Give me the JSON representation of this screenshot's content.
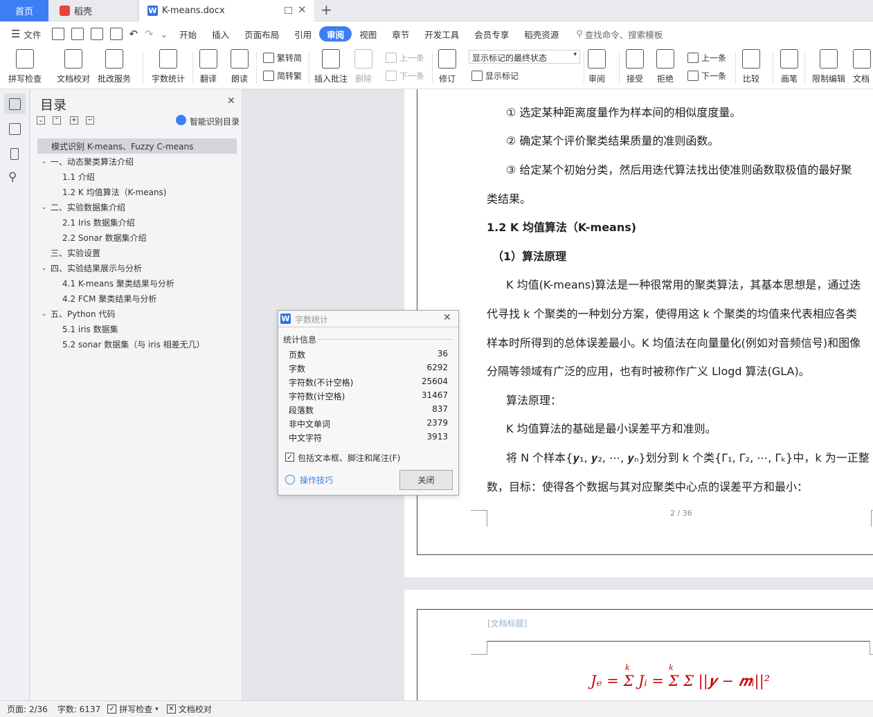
{
  "tabs": {
    "home": "首页",
    "daoke": "稻壳",
    "doc": "K-means.docx",
    "add": "+"
  },
  "menu": {
    "file": "文件",
    "items": [
      "开始",
      "插入",
      "页面布局",
      "引用",
      "审阅",
      "视图",
      "章节",
      "开发工具",
      "会员专享",
      "稻壳资源"
    ],
    "active": "审阅",
    "search": "查找命令、搜索模板"
  },
  "ribbon": {
    "spell": "拼写检查",
    "proof": "文档校对",
    "batch": "批改服务",
    "wordcount": "字数统计",
    "translate": "翻译",
    "read": "朗读",
    "trad": "繁转简",
    "simp": "简转繁",
    "insert_comment": "插入批注",
    "delete": "删除",
    "prev": "上一条",
    "next": "下一条",
    "revise": "修订",
    "markup_state": "显示标记的最终状态",
    "show_markup": "显示标记",
    "review": "审阅",
    "accept": "接受",
    "reject": "拒绝",
    "prev2": "上一条",
    "next2": "下一条",
    "compare": "比较",
    "pen": "画笔",
    "restrict": "限制编辑",
    "docperm": "文档"
  },
  "nav": {
    "title": "目录",
    "smart": "智能识别目录",
    "items": [
      {
        "text": "模式识别  K-means、Fuzzy C-means",
        "level": 0,
        "sel": true
      },
      {
        "text": "一、动态聚类算法介绍",
        "level": 1,
        "chev": true
      },
      {
        "text": "1.1  介绍",
        "level": 2
      },
      {
        "text": "1.2 K 均值算法（K-means)",
        "level": 2
      },
      {
        "text": "二、实验数据集介绍",
        "level": 1,
        "chev": true
      },
      {
        "text": "2.1 Iris 数据集介绍",
        "level": 2
      },
      {
        "text": "2.2 Sonar 数据集介绍",
        "level": 2
      },
      {
        "text": "三、实验设置",
        "level": 1
      },
      {
        "text": "四、实验结果展示与分析",
        "level": 1,
        "chev": true
      },
      {
        "text": "4.1 K-means 聚类结果与分析",
        "level": 2
      },
      {
        "text": "4.2 FCM 聚类结果与分析",
        "level": 2
      },
      {
        "text": "五、Python 代码",
        "level": 1,
        "chev": true
      },
      {
        "text": "5.1 iris 数据集",
        "level": 2
      },
      {
        "text": "5.2 sonar 数据集（与 iris 相差无几）",
        "level": 2
      }
    ]
  },
  "doc": {
    "lines": [
      "① 选定某种距离度量作为样本间的相似度度量。",
      "② 确定某个评价聚类结果质量的准则函数。",
      "③ 给定某个初始分类，然后用迭代算法找出使准则函数取极值的最好聚",
      "类结果。",
      "1.2 K 均值算法（K-means)",
      "（1）算法原理",
      "K 均值(K-means)算法是一种很常用的聚类算法，其基本思想是，通过迭",
      "代寻找 k 个聚类的一种划分方案，使得用这 k 个聚类的均值来代表相应各类",
      "样本时所得到的总体误差最小。K 均值法在向量量化(例如对音频信号)和图像",
      "分隔等领域有广泛的应用，也有时被称作广义 Llogd 算法(GLA)。",
      "算法原理：",
      "K 均值算法的基础是最小误差平方和准则。",
      "将 N 个样本{𝒚₁, 𝒚₂, ⋯, 𝒚ₙ}划分到 k 个类{Γ₁, Γ₂, ⋯, Γₖ}中，k 为一正整",
      "数，目标：使得各个数据与其对应聚类中心点的误差平方和最小："
    ],
    "page_num": "2 / 36",
    "header_placeholder": "[文档标题]",
    "formula": "Jₑ = Σ Jᵢ = Σ Σ ||𝒚 − 𝒎ᵢ||²",
    "formula_sup": "k"
  },
  "dialog": {
    "title": "字数统计",
    "section": "统计信息",
    "rows": [
      {
        "label": "页数",
        "value": "36"
      },
      {
        "label": "字数",
        "value": "6292"
      },
      {
        "label": "字符数(不计空格)",
        "value": "25604"
      },
      {
        "label": "字符数(计空格)",
        "value": "31467"
      },
      {
        "label": "段落数",
        "value": "837"
      },
      {
        "label": "非中文单词",
        "value": "2379"
      },
      {
        "label": "中文字符",
        "value": "3913"
      }
    ],
    "checkbox": "包括文本框、脚注和尾注(F)",
    "tips": "操作技巧",
    "close": "关闭"
  },
  "status": {
    "page": "页面: 2/36",
    "words": "字数: 6137",
    "spell": "拼写检查",
    "proof": "文档校对"
  },
  "colors": {
    "accent": "#3d7ef5",
    "formula": "#cc0000"
  }
}
